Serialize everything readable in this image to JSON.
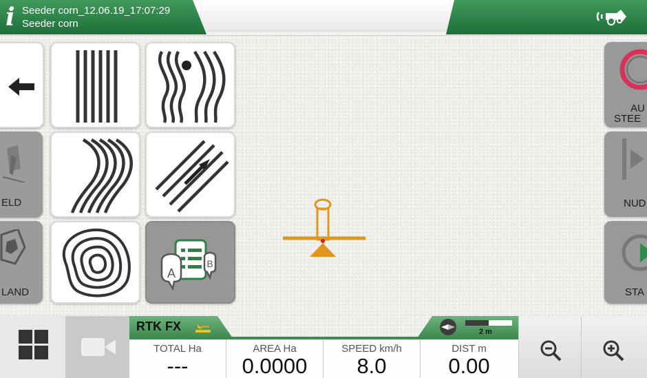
{
  "header": {
    "job_title": "Seeder corn_12.06.19_17:07:29",
    "job_subtitle": "Seeder corn",
    "info_icon": "info-icon",
    "signal_icon": "tractor-signal-icon"
  },
  "left_panel": {
    "back_button_icon": "back-arrow-icon",
    "field_label": "ELD",
    "land_label": "LAND",
    "guidance_modes": [
      {
        "name": "straight-ab-lines",
        "icon": "straight-lines-icon"
      },
      {
        "name": "free-curve",
        "icon": "free-curve-icon"
      },
      {
        "name": "curved-ab-lines",
        "icon": "curved-lines-icon"
      },
      {
        "name": "ab-heading-lines",
        "icon": "heading-lines-icon"
      },
      {
        "name": "circular-pivot",
        "icon": "concentric-contour-icon"
      },
      {
        "name": "lines-manager",
        "icon": "ab-lines-manager-icon"
      }
    ]
  },
  "right_panel": {
    "auto_steer_label_1": "AU",
    "auto_steer_label_2": "STEE",
    "nudge_label": "NUD",
    "start_label": "STA"
  },
  "status": {
    "gps_label": "RTK FX",
    "scale_label": "2 m"
  },
  "metrics": [
    {
      "label": "TOTAL Ha",
      "value": "---"
    },
    {
      "label": "AREA Ha",
      "value": "0.0000"
    },
    {
      "label": "SPEED km/h",
      "value": "8.0"
    },
    {
      "label": "DIST m",
      "value": "0.00"
    }
  ],
  "colors": {
    "brand_green": "#2e8046",
    "status_green": "#4e9b5f",
    "vehicle_orange": "#e0951c",
    "gray_button": "#999999"
  }
}
